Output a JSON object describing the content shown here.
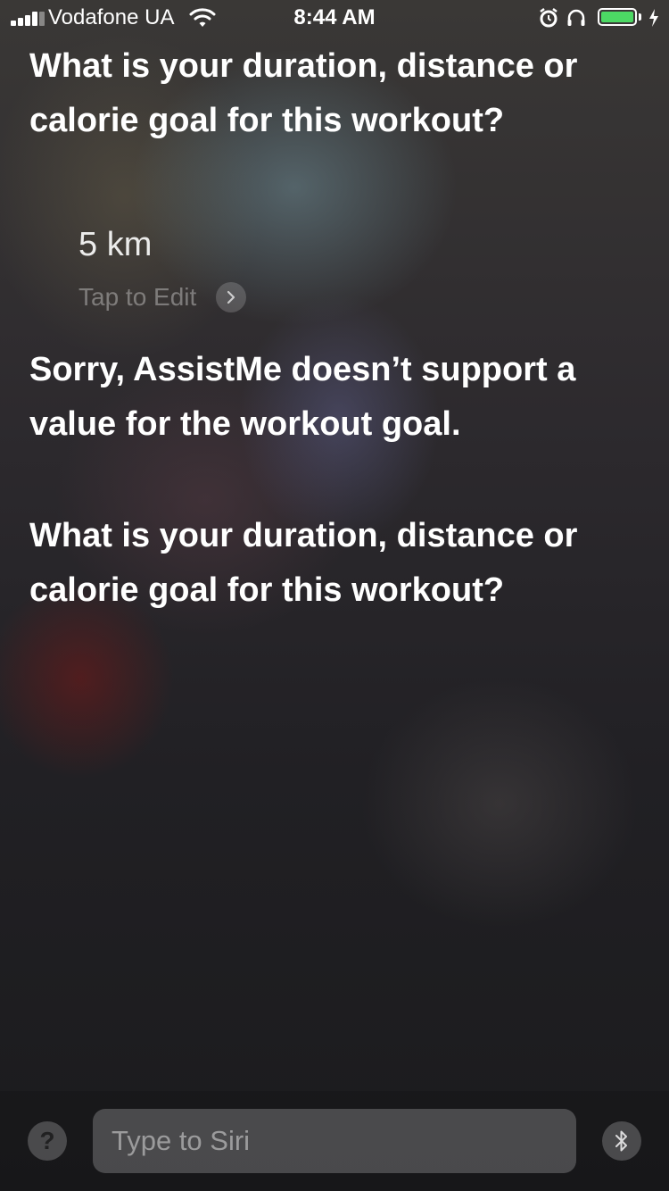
{
  "status_bar": {
    "carrier": "Vodafone UA",
    "time": "8:44 AM",
    "battery_level": 1.0,
    "charging": true,
    "icons": [
      "signal-icon",
      "wifi-icon",
      "alarm-icon",
      "headphones-icon",
      "battery-icon",
      "bolt-icon"
    ]
  },
  "conversation": {
    "siri_prompt_1": "What is your duration, distance or calorie goal for this workout?",
    "user_value": "5 km",
    "tap_to_edit": "Tap to Edit",
    "siri_response": "Sorry, AssistMe doesn’t support a value for the workout goal.",
    "siri_prompt_2": "What is your duration, distance or calorie goal for this workout?"
  },
  "bottom_bar": {
    "help_label": "?",
    "input_placeholder": "Type to Siri",
    "icons": [
      "help-icon",
      "bluetooth-icon"
    ]
  },
  "colors": {
    "battery_fill": "#4cd964",
    "text": "#ffffff"
  }
}
